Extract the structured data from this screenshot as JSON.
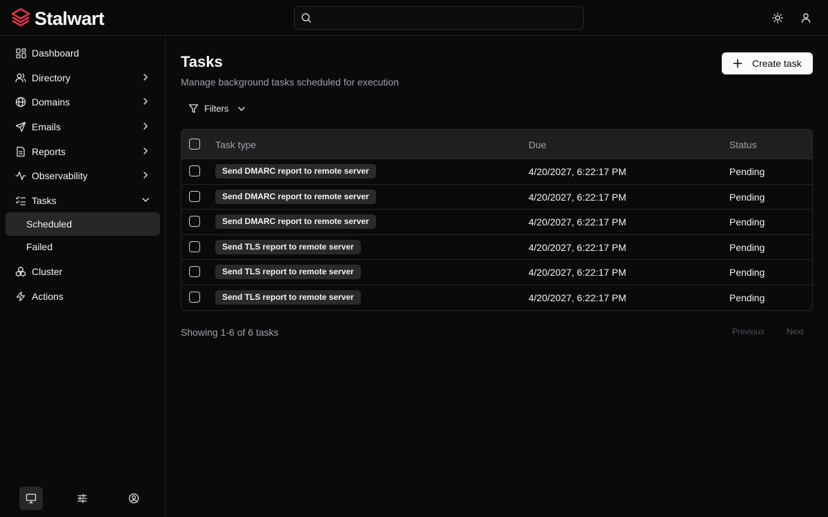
{
  "app": {
    "logo_text": "Stalwart",
    "brand_color": "#e5314a"
  },
  "header": {
    "search_placeholder": "",
    "icons": [
      "search-icon",
      "sun-icon",
      "user-icon"
    ]
  },
  "sidebar": {
    "items": [
      {
        "label": "Dashboard",
        "icon": "dashboard-icon"
      },
      {
        "label": "Directory",
        "icon": "users-icon"
      },
      {
        "label": "Domains",
        "icon": "globe-icon"
      },
      {
        "label": "Emails",
        "icon": "send-icon"
      },
      {
        "label": "Reports",
        "icon": "file-icon"
      },
      {
        "label": "Observability",
        "icon": "activity-icon"
      },
      {
        "label": "Tasks",
        "icon": "list-check-icon"
      },
      {
        "label": "Scheduled"
      },
      {
        "label": "Failed"
      },
      {
        "label": "Cluster",
        "icon": "cluster-icon"
      },
      {
        "label": "Actions",
        "icon": "zap-icon"
      }
    ],
    "bottom_icons": [
      "monitor-icon",
      "sliders-icon",
      "user-circle-icon"
    ]
  },
  "main": {
    "title": "Tasks",
    "subtitle": "Manage background tasks scheduled for execution",
    "create_button": "Create task",
    "filters_label": "Filters",
    "table": {
      "columns": [
        "Task type",
        "Due",
        "Status"
      ],
      "rows": [
        {
          "type": "Send DMARC report to remote server",
          "due": "4/20/2027, 6:22:17 PM",
          "status": "Pending"
        },
        {
          "type": "Send DMARC report to remote server",
          "due": "4/20/2027, 6:22:17 PM",
          "status": "Pending"
        },
        {
          "type": "Send DMARC report to remote server",
          "due": "4/20/2027, 6:22:17 PM",
          "status": "Pending"
        },
        {
          "type": "Send TLS report to remote server",
          "due": "4/20/2027, 6:22:17 PM",
          "status": "Pending"
        },
        {
          "type": "Send TLS report to remote server",
          "due": "4/20/2027, 6:22:17 PM",
          "status": "Pending"
        },
        {
          "type": "Send TLS report to remote server",
          "due": "4/20/2027, 6:22:17 PM",
          "status": "Pending"
        }
      ]
    },
    "showing": "Showing 1-6 of 6 tasks",
    "pagination": {
      "previous": "Previous",
      "next": "Next"
    }
  }
}
